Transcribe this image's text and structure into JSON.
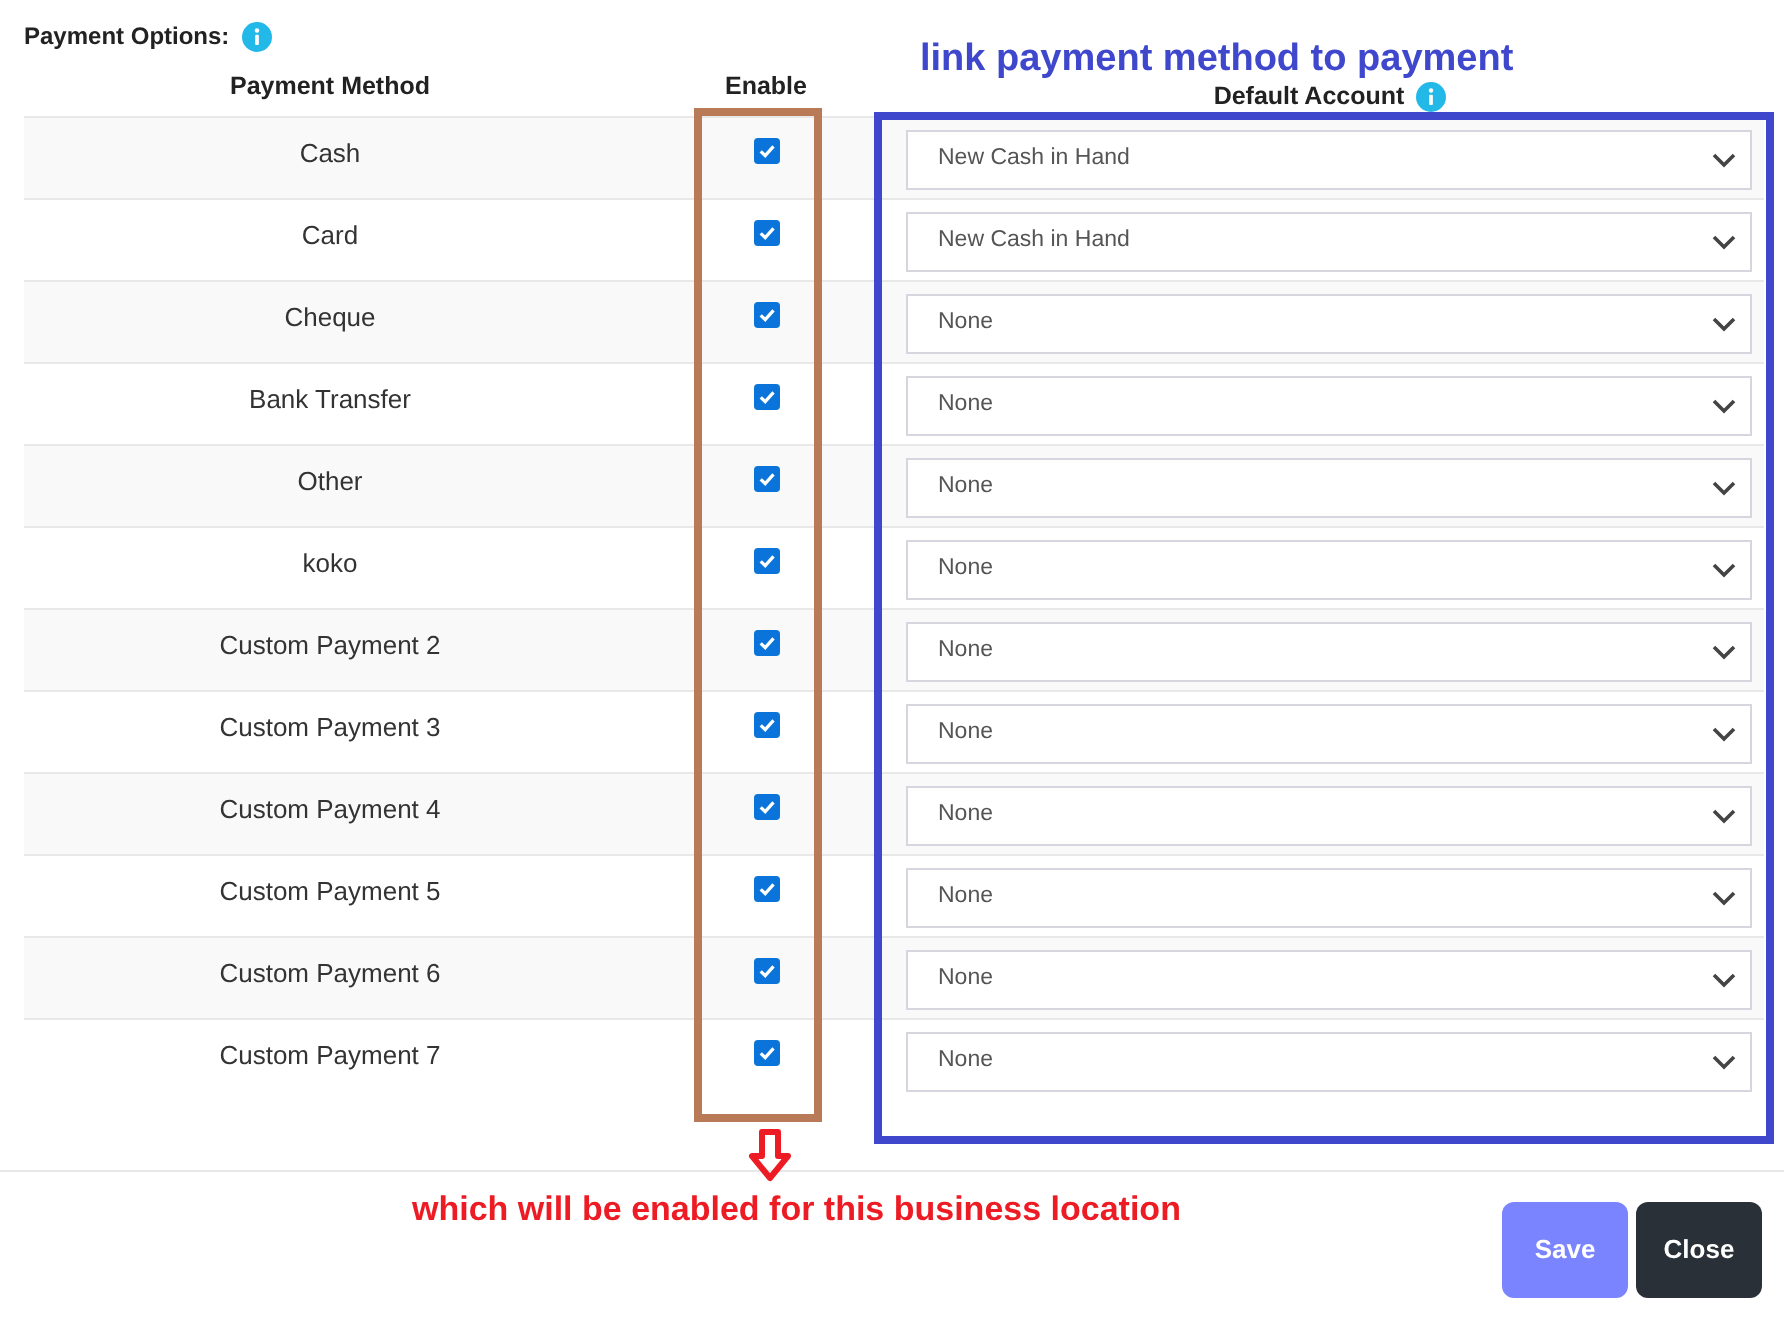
{
  "title": "Payment Options:",
  "columns": [
    "Payment Method",
    "Enable",
    "Default Account"
  ],
  "rows": [
    {
      "method": "Cash",
      "enabled": true,
      "account": "New Cash in Hand"
    },
    {
      "method": "Card",
      "enabled": true,
      "account": "New Cash in Hand"
    },
    {
      "method": "Cheque",
      "enabled": true,
      "account": "None"
    },
    {
      "method": "Bank Transfer",
      "enabled": true,
      "account": "None"
    },
    {
      "method": "Other",
      "enabled": true,
      "account": "None"
    },
    {
      "method": "koko",
      "enabled": true,
      "account": "None"
    },
    {
      "method": "Custom Payment 2",
      "enabled": true,
      "account": "None"
    },
    {
      "method": "Custom Payment 3",
      "enabled": true,
      "account": "None"
    },
    {
      "method": "Custom Payment 4",
      "enabled": true,
      "account": "None"
    },
    {
      "method": "Custom Payment 5",
      "enabled": true,
      "account": "None"
    },
    {
      "method": "Custom Payment 6",
      "enabled": true,
      "account": "None"
    },
    {
      "method": "Custom Payment 7",
      "enabled": true,
      "account": "None"
    }
  ],
  "annotations": {
    "top": "link payment method to payment",
    "bottom": "which will be enabled for this business location"
  },
  "buttons": [
    {
      "label": "Save",
      "kind": "primary"
    },
    {
      "label": "Close",
      "kind": "dark"
    }
  ]
}
